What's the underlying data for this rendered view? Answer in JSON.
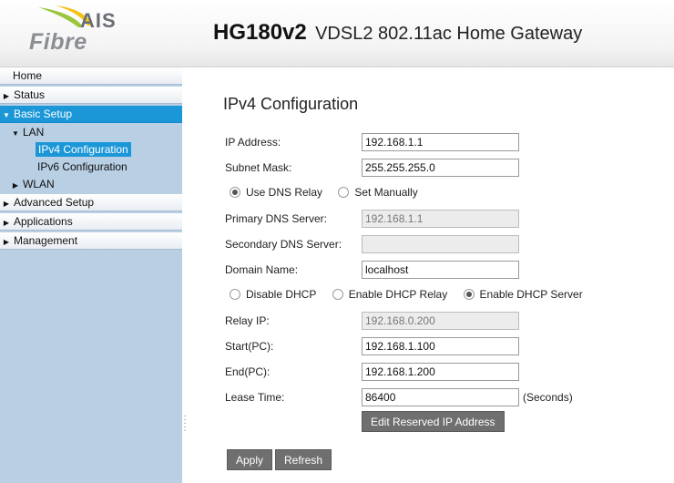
{
  "header": {
    "logo_text_top": "AIS",
    "logo_text_bottom": "Fibre",
    "model": "HG180v2",
    "description": "VDSL2 802.11ac Home Gateway"
  },
  "sidebar": {
    "items": [
      {
        "label": "Home",
        "arrow": ""
      },
      {
        "label": "Status",
        "arrow": "▶"
      },
      {
        "label": "Basic Setup",
        "arrow": "▼"
      },
      {
        "label": "LAN",
        "arrow": "▼"
      },
      {
        "label": "IPv4 Configuration",
        "arrow": ""
      },
      {
        "label": "IPv6 Configuration",
        "arrow": ""
      },
      {
        "label": "WLAN",
        "arrow": "▶"
      },
      {
        "label": "Advanced Setup",
        "arrow": "▶"
      },
      {
        "label": "Applications",
        "arrow": "▶"
      },
      {
        "label": "Management",
        "arrow": "▶"
      }
    ]
  },
  "main": {
    "title": "IPv4 Configuration",
    "ip_address_label": "IP Address:",
    "ip_address_value": "192.168.1.1",
    "subnet_mask_label": "Subnet Mask:",
    "subnet_mask_value": "255.255.255.0",
    "dns_mode_options": [
      "Use DNS Relay",
      "Set Manually"
    ],
    "dns_mode_selected": "Use DNS Relay",
    "primary_dns_label": "Primary DNS Server:",
    "primary_dns_value": "192.168.1.1",
    "secondary_dns_label": "Secondary DNS Server:",
    "secondary_dns_value": "",
    "domain_name_label": "Domain Name:",
    "domain_name_value": "localhost",
    "dhcp_mode_options": [
      "Disable DHCP",
      "Enable DHCP Relay",
      "Enable DHCP Server"
    ],
    "dhcp_mode_selected": "Enable DHCP Server",
    "relay_ip_label": "Relay IP:",
    "relay_ip_value": "192.168.0.200",
    "start_pc_label": "Start(PC):",
    "start_pc_value": "192.168.1.100",
    "end_pc_label": "End(PC):",
    "end_pc_value": "192.168.1.200",
    "lease_time_label": "Lease Time:",
    "lease_time_value": "86400",
    "lease_time_unit": "(Seconds)",
    "edit_reserved_label": "Edit Reserved IP Address",
    "apply_label": "Apply",
    "refresh_label": "Refresh"
  },
  "colors": {
    "sidebar_bg": "#b8cfe4",
    "active_blue": "#1b97d8",
    "button_gray": "#6f6f6f",
    "logo_yellow": "#f0c419"
  }
}
